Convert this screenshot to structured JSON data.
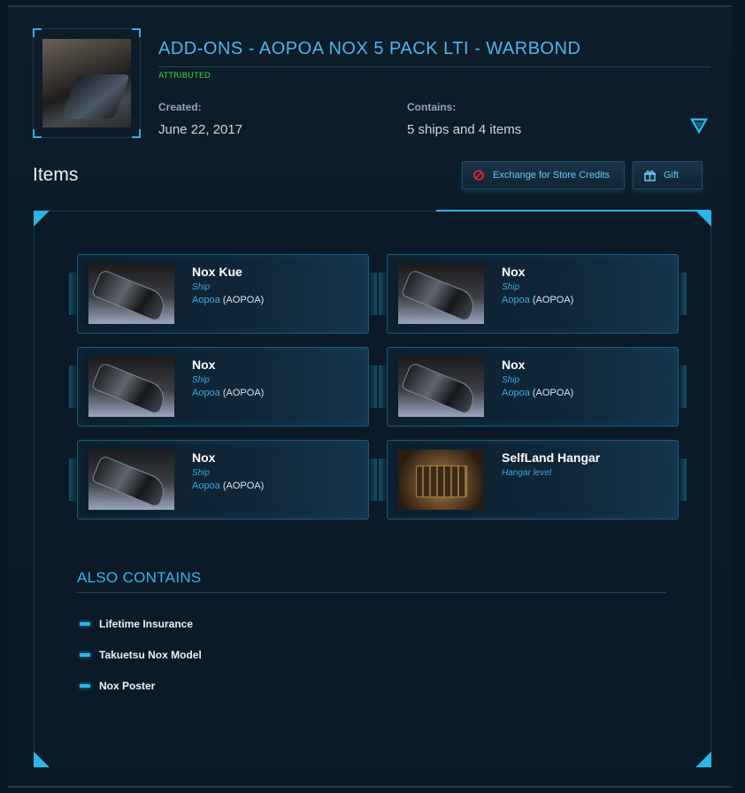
{
  "pledge": {
    "title": "ADD-ONS - AOPOA NOX 5 PACK LTI - WARBOND",
    "status": "ATTRIBUTED",
    "created_label": "Created:",
    "created_value": "June 22, 2017",
    "contains_label": "Contains:",
    "contains_value": "5 ships and 4 items"
  },
  "items_section": {
    "heading": "Items",
    "exchange_label": "Exchange for Store Credits",
    "gift_label": "Gift"
  },
  "items": [
    {
      "name": "Nox Kue",
      "type": "Ship",
      "maker": "Aopoa",
      "code": "(AOPOA)"
    },
    {
      "name": "Nox",
      "type": "Ship",
      "maker": "Aopoa",
      "code": "(AOPOA)"
    },
    {
      "name": "Nox",
      "type": "Ship",
      "maker": "Aopoa",
      "code": "(AOPOA)"
    },
    {
      "name": "Nox",
      "type": "Ship",
      "maker": "Aopoa",
      "code": "(AOPOA)"
    },
    {
      "name": "Nox",
      "type": "Ship",
      "maker": "Aopoa",
      "code": "(AOPOA)"
    },
    {
      "name": "SelfLand Hangar",
      "type": "Hangar level",
      "maker": "",
      "code": ""
    }
  ],
  "also_contains": {
    "heading": "ALSO CONTAINS",
    "entries": [
      "Lifetime Insurance",
      "Takuetsu Nox Model",
      "Nox Poster"
    ]
  },
  "colors": {
    "accent": "#2bb4e6",
    "title": "#4fb5ec",
    "status": "#35d63a",
    "background": "#0a1720"
  },
  "icons": {
    "exchange": "no-entry-icon",
    "gift": "gift-icon",
    "toggle": "triangle-down-icon"
  }
}
